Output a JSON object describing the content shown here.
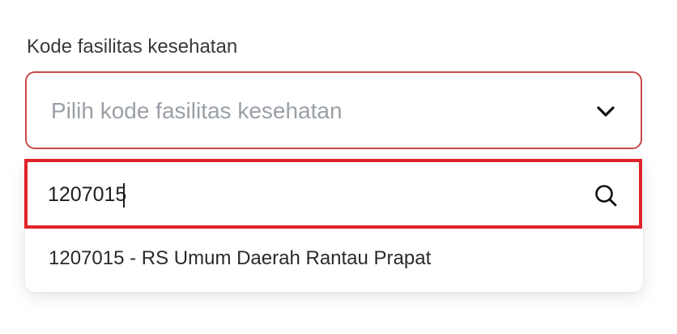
{
  "form": {
    "label": "Kode fasilitas kesehatan",
    "select": {
      "placeholder": "Pilih kode fasilitas kesehatan",
      "icon": "chevron-down-icon"
    }
  },
  "dropdown": {
    "search": {
      "value": "1207015",
      "icon": "search-icon"
    },
    "options": [
      {
        "label": "1207015 - RS Umum Daerah Rantau Prapat"
      }
    ]
  },
  "colors": {
    "select_border": "#c94a4a",
    "search_highlight_border": "#e0222a",
    "placeholder_text": "#9aa0a6",
    "label_text": "#3a3a3a"
  }
}
